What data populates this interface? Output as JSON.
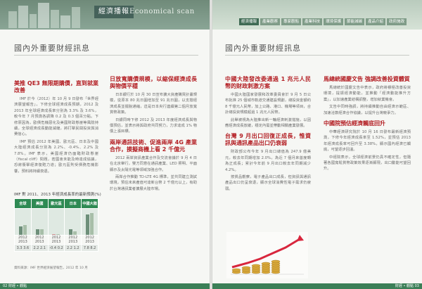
{
  "left": {
    "header_title": "經濟播報",
    "header_sub": "Economical scan",
    "section_title": "國內外重要財經訊息",
    "col1": {
      "headline": "美推 QE3 無限期購債，直到就業改善",
      "paras": [
        "IMF 於今（2012）年 10 月 9 日發布「世界經濟展望報告」，下修全球經濟成長預期，2012 及 2013 年全球經濟成長率分別為 3.3% 及 3.6%，較今年 7 月預測各調降 0.2 及 0.3 個百分點。下修原因為，歐債危機惡化及美國財政懸崖等風險持續，全球經濟成長動能減緩，將打擊民間投資與消費信心。",
        "IMF 預估 2012 年美國、歐元區、日本及中國大陸經濟成長分別為 2.2%、-0.4%、2.2% 及 7.8%。IMF 表示，美國經濟仍面臨財政懸崖（fiscal cliff）問題，若國會未能及時達成協議，恐將衝擊經濟復甦力道；歐元區則受債務危機影響，預料將持續衰退。"
      ]
    },
    "col2": {
      "headline1": "日放寬購債規模，以縮保經濟成長與物價平穩",
      "paras1": [
        "日本銀行於 10 月 30 日宣布擴大資產購買計畫規模，從原本 80 兆日圓增加至 91 兆日圓，以支撐經濟成長並擺脫通縮，這是日本央行連續第二個月放寬貨幣政策。",
        "日銀同時下修 2012 及 2013 年度經濟成長與物價預估，並表示將與政府共同努力，力求達成 1% 物價上漲目標。"
      ],
      "headline2": "兩岸通訊技術、促進兩岸 4G 產業合作，摸擬商機上看 2 千億元",
      "paras2": [
        "2012 兩岸資訊產業合作及交流會議於 9 月 4 日在北京舉行，雙方同意在通訊產業、LED 照明、平面顯示及太陽光電等領域加強合作。",
        "兩岸合作推動 TD-LTE 4G 標準，並共同建立測試環境，預估未來產值可達新台幣 2 千億元以上，有助於台灣通訊業者擴展大陸市場。"
      ]
    },
    "table": {
      "caption": "IMF 對 2011、2013 年經濟成長率的最新預測(%)",
      "headers": [
        "全球",
        "美國",
        "歐元區",
        "日本",
        "中國大陸"
      ],
      "years": [
        "2012",
        "2013"
      ],
      "values": [
        [
          "3.3",
          "3.6"
        ],
        [
          "2.2",
          "2.1"
        ],
        [
          "-0.4",
          "0.2"
        ],
        [
          "2.2",
          "1.2"
        ],
        [
          "7.8",
          "8.2"
        ]
      ],
      "source": "資料來源：IMF 世界經濟展望報告，2012 年 10 月"
    },
    "footer": "02  財經 • 觀點"
  },
  "right": {
    "section_title": "國內外重要財經訊息",
    "nav": [
      "經濟播報",
      "產業觀察",
      "專家觀點",
      "產業科技",
      "環境保護",
      "節能減碳",
      "產品介紹",
      "政府施政"
    ],
    "col1": {
      "headline1": "中國大陸發改委通過 1 兆元人民幣的財政刺激方案",
      "paras1": [
        "中國大陸國家發展和改革委員會於 9 月 5 日公布批准 25 個城市軌道交通建設規劃，總投資金額約 8 千億元人民幣，加上公路、港口、機場等項目，合計總投資規模超過 1 兆元人民幣。",
        "此舉被視為大陸推出新一輪經濟刺激措施，以因應經濟成長放緩，穩定內需並帶動相關產業發展。"
      ],
      "headline2": "台灣 9 月出口回復正成長，惟資訊與通訊產品出口仍衰弱",
      "paras2": [
        "財政部公布今年 9 月出口總值為 247.9 億美元，較去年同期增加 2.0%，為近 7 個月來首度轉為正成長；累計今年前 9 月出口較去年同期減少 4.2%。",
        "按貨品觀察，電子產品出口成長，但資訊與通訊產品出口仍呈衰退，顯示全球消費性電子需求仍疲弱。"
      ]
    },
    "col2": {
      "headline1": "馬總統國慶文告 強調改善投資體質",
      "paras1": [
        "馬總統於國慶文告中表示，政府將積極改善投資環境，提振經濟動能，並推動「經濟動能推升方案」，以加速產業結構調整，增加就業機會。",
        "文告中同時強調，將持續推動自由經濟示範區、加速洽簽經濟合作協議，以提升台灣競爭力。"
      ],
      "headline2": "中國院預估經濟觸底回升",
      "paras2": [
        "中華經濟研究院於 10 月 16 日發布最新經濟預測，下修今年經濟成長率至 1.52%，並預估 2013 年經濟成長率可回升至 3.38%，顯示國內經濟已觸底，可望逐步回溫。",
        "中經院表示，全球經濟前景仍具不確定性，但隨著各國寬鬆貨幣政策效果逐漸顯現，出口動能可望回升。"
      ]
    },
    "footer": "財經 • 觀點  03"
  },
  "colors": {
    "accent_red": "#b42025",
    "header_green": "#2e8a53"
  }
}
